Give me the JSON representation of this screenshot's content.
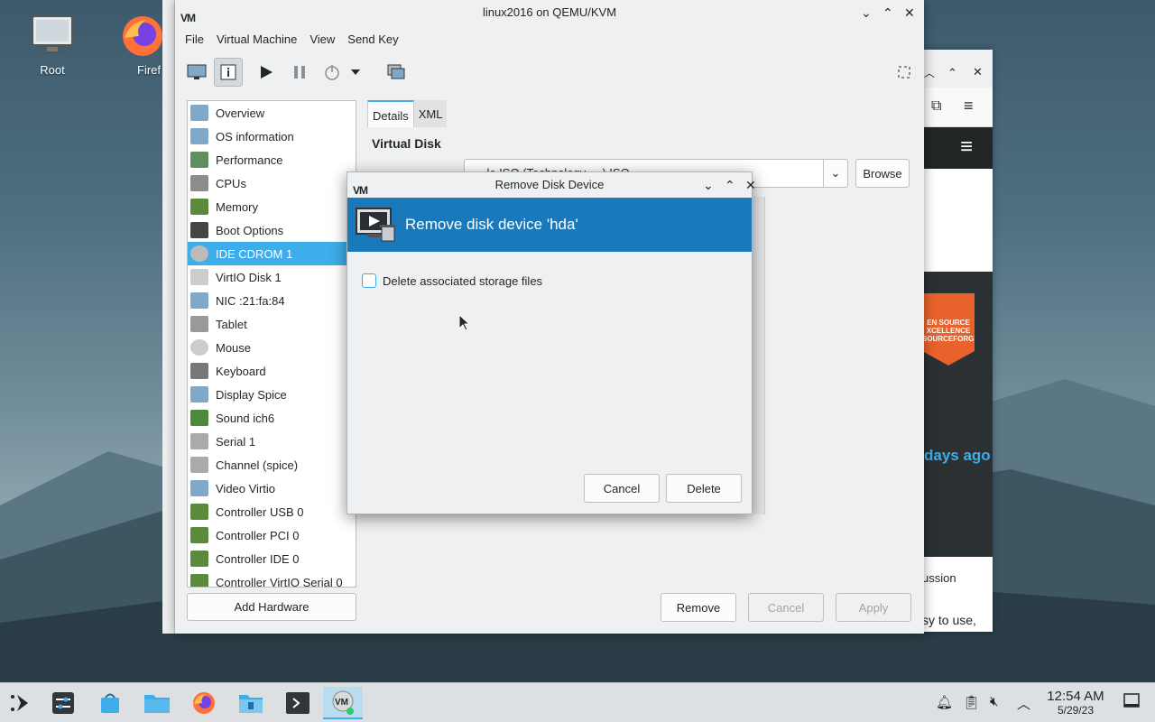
{
  "desktop": {
    "icons": [
      {
        "label": "Root"
      },
      {
        "label": "Firef"
      }
    ]
  },
  "browser": {
    "badge_text": "EN SOURCE XCELLENCE SOURCEFORGE",
    "days_text": "days ago",
    "text1": "ussion",
    "text2": "sy to use,"
  },
  "window": {
    "title": "linux2016 on QEMU/KVM",
    "logo": "VM",
    "menu": [
      "File",
      "Virtual Machine",
      "View",
      "Send Key"
    ],
    "devices": [
      {
        "label": "Overview",
        "icon": "monitor-icon",
        "color": "#7fa8c9"
      },
      {
        "label": "OS information",
        "icon": "os-info-icon",
        "color": "#7fa8c9"
      },
      {
        "label": "Performance",
        "icon": "performance-icon",
        "color": "#5e8f5e"
      },
      {
        "label": "CPUs",
        "icon": "cpu-icon",
        "color": "#8c8c8c"
      },
      {
        "label": "Memory",
        "icon": "memory-icon",
        "color": "#5b8a3a"
      },
      {
        "label": "Boot Options",
        "icon": "boot-icon",
        "color": "#444444"
      },
      {
        "label": "IDE CDROM 1",
        "icon": "cdrom-icon",
        "color": "#bbbbbb"
      },
      {
        "label": "VirtIO Disk 1",
        "icon": "disk-icon",
        "color": "#cccccc"
      },
      {
        "label": "NIC :21:fa:84",
        "icon": "nic-icon",
        "color": "#7fa8c9"
      },
      {
        "label": "Tablet",
        "icon": "tablet-icon",
        "color": "#999999"
      },
      {
        "label": "Mouse",
        "icon": "mouse-icon",
        "color": "#cccccc"
      },
      {
        "label": "Keyboard",
        "icon": "keyboard-icon",
        "color": "#777777"
      },
      {
        "label": "Display Spice",
        "icon": "display-icon",
        "color": "#7fa8c9"
      },
      {
        "label": "Sound ich6",
        "icon": "sound-icon",
        "color": "#4a8a3a"
      },
      {
        "label": "Serial 1",
        "icon": "serial-icon",
        "color": "#aaaaaa"
      },
      {
        "label": "Channel (spice)",
        "icon": "channel-icon",
        "color": "#aaaaaa"
      },
      {
        "label": "Video Virtio",
        "icon": "video-icon",
        "color": "#7fa8c9"
      },
      {
        "label": "Controller USB 0",
        "icon": "controller-icon",
        "color": "#5b8a3a"
      },
      {
        "label": "Controller PCI 0",
        "icon": "controller-icon",
        "color": "#5b8a3a"
      },
      {
        "label": "Controller IDE 0",
        "icon": "controller-icon",
        "color": "#5b8a3a"
      },
      {
        "label": "Controller VirtIO Serial 0",
        "icon": "controller-icon",
        "color": "#5b8a3a"
      }
    ],
    "selected_device": "IDE CDROM 1",
    "add_hardware": "Add Hardware",
    "tabs": [
      "Details",
      "XML"
    ],
    "section_title": "Virtual Disk",
    "path_value": "... le.ISO (Technology ... ).ISO",
    "browse": "Browse",
    "remove": "Remove",
    "cancel": "Cancel",
    "apply": "Apply"
  },
  "dialog": {
    "title": "Remove Disk Device",
    "banner": "Remove disk device 'hda'",
    "checkbox_label": "Delete associated storage files",
    "checkbox_checked": false,
    "cancel": "Cancel",
    "delete": "Delete"
  },
  "taskbar": {
    "time": "12:54 AM",
    "date": "5/29/23"
  },
  "colors": {
    "accent": "#3daee9",
    "banner": "#1a79ba"
  }
}
